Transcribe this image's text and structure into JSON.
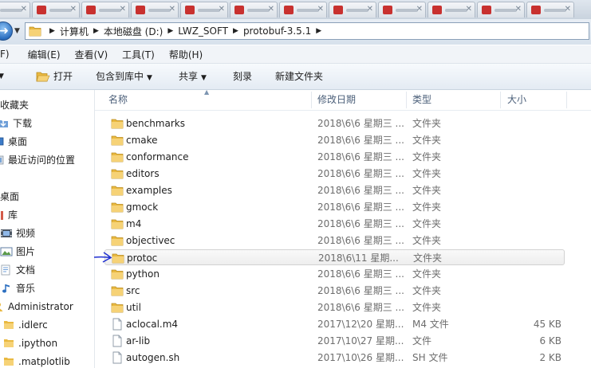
{
  "address": {
    "crumbs": [
      "计算机",
      "本地磁盘 (D:)",
      "LWZ_SOFT",
      "protobuf-3.5.1"
    ]
  },
  "menubar": {
    "items": [
      "F)",
      "编辑(E)",
      "查看(V)",
      "工具(T)",
      "帮助(H)"
    ]
  },
  "toolbar": {
    "open": "打开",
    "include_library": "包含到库中",
    "share": "共享",
    "burn": "刻录",
    "new_folder": "新建文件夹"
  },
  "nav": {
    "favorites": "收藏夹",
    "downloads": "下载",
    "desktop_fav": "桌面",
    "recent": "最近访问的位置",
    "desktop": "桌面",
    "libraries": "库",
    "videos": "视频",
    "pictures": "图片",
    "documents": "文档",
    "music": "音乐",
    "admin": "Administrator",
    "idlerc": ".idlerc",
    "ipython": ".ipython",
    "matplotlib": ".matplotlib"
  },
  "columns": {
    "name": "名称",
    "date": "修改日期",
    "type": "类型",
    "size": "大小"
  },
  "files": [
    {
      "name": "benchmarks",
      "date": "2018\\6\\6 星期三 ...",
      "type": "文件夹",
      "size": "",
      "kind": "folder"
    },
    {
      "name": "cmake",
      "date": "2018\\6\\6 星期三 ...",
      "type": "文件夹",
      "size": "",
      "kind": "folder"
    },
    {
      "name": "conformance",
      "date": "2018\\6\\6 星期三 ...",
      "type": "文件夹",
      "size": "",
      "kind": "folder"
    },
    {
      "name": "editors",
      "date": "2018\\6\\6 星期三 ...",
      "type": "文件夹",
      "size": "",
      "kind": "folder"
    },
    {
      "name": "examples",
      "date": "2018\\6\\6 星期三 ...",
      "type": "文件夹",
      "size": "",
      "kind": "folder"
    },
    {
      "name": "gmock",
      "date": "2018\\6\\6 星期三 ...",
      "type": "文件夹",
      "size": "",
      "kind": "folder"
    },
    {
      "name": "m4",
      "date": "2018\\6\\6 星期三 ...",
      "type": "文件夹",
      "size": "",
      "kind": "folder"
    },
    {
      "name": "objectivec",
      "date": "2018\\6\\6 星期三 ...",
      "type": "文件夹",
      "size": "",
      "kind": "folder"
    },
    {
      "name": "protoc",
      "date": "2018\\6\\11 星期...",
      "type": "文件夹",
      "size": "",
      "kind": "folder"
    },
    {
      "name": "python",
      "date": "2018\\6\\6 星期三 ...",
      "type": "文件夹",
      "size": "",
      "kind": "folder"
    },
    {
      "name": "src",
      "date": "2018\\6\\6 星期三 ...",
      "type": "文件夹",
      "size": "",
      "kind": "folder"
    },
    {
      "name": "util",
      "date": "2018\\6\\6 星期三 ...",
      "type": "文件夹",
      "size": "",
      "kind": "folder"
    },
    {
      "name": "aclocal.m4",
      "date": "2017\\12\\20 星期...",
      "type": "M4 文件",
      "size": "45 KB",
      "kind": "file"
    },
    {
      "name": "ar-lib",
      "date": "2017\\10\\27 星期...",
      "type": "文件",
      "size": "6 KB",
      "kind": "file"
    },
    {
      "name": "autogen.sh",
      "date": "2017\\10\\26 星期...",
      "type": "SH 文件",
      "size": "2 KB",
      "kind": "file"
    }
  ],
  "selected_index": 8,
  "colors": {
    "accent": "#2c6fc0",
    "folder": "#e9b941",
    "annotation_arrow": "#1f2fd1"
  }
}
